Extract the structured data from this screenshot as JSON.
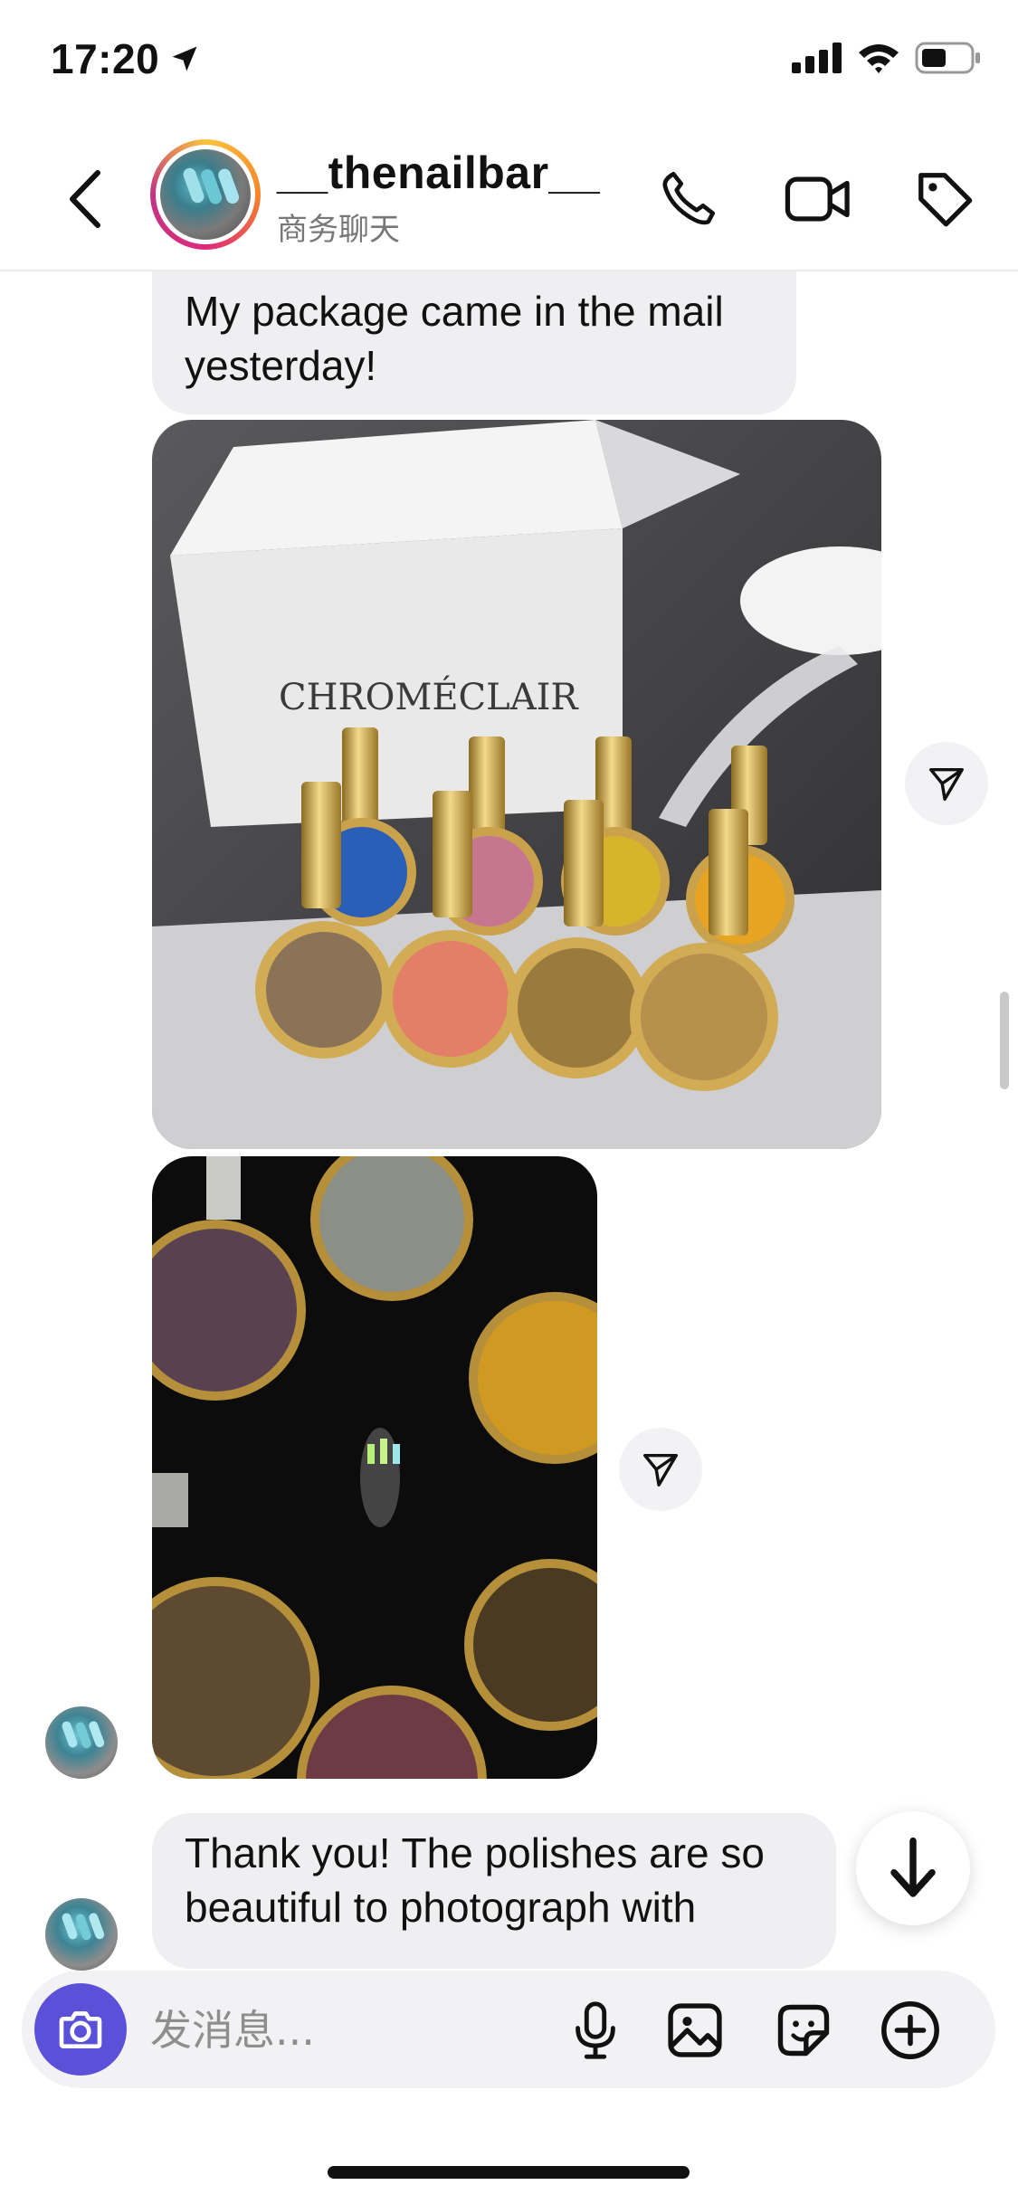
{
  "status_bar": {
    "time": "17:20",
    "location_icon": "location-arrow-icon",
    "signal_icon": "cellular-signal-icon",
    "wifi_icon": "wifi-icon",
    "battery_icon": "battery-icon"
  },
  "header": {
    "back_icon": "chevron-left-icon",
    "contact_name": "__thenailbar__",
    "contact_subtitle": "商务聊天",
    "call_icon": "phone-icon",
    "video_icon": "video-camera-icon",
    "tag_icon": "tag-icon",
    "story_ring_colors": [
      "#f9c23c",
      "#f58529",
      "#dd2a7b",
      "#c13584"
    ]
  },
  "messages": [
    {
      "type": "text",
      "text": "My package came in the mail yesterday!"
    },
    {
      "type": "image",
      "content": "photo",
      "share_icon": "share-plane-icon"
    },
    {
      "type": "image",
      "content": "photo",
      "share_icon": "share-plane-icon"
    },
    {
      "type": "text",
      "text": "Thank you! The polishes are so beautiful to photograph with"
    }
  ],
  "scroll_down_icon": "arrow-down-icon",
  "composer": {
    "placeholder": "发消息...",
    "camera_icon": "camera-icon",
    "mic_icon": "microphone-icon",
    "gallery_icon": "image-icon",
    "sticker_icon": "sticker-icon",
    "add_icon": "plus-circle-icon",
    "camera_color": "#5b51d8"
  }
}
